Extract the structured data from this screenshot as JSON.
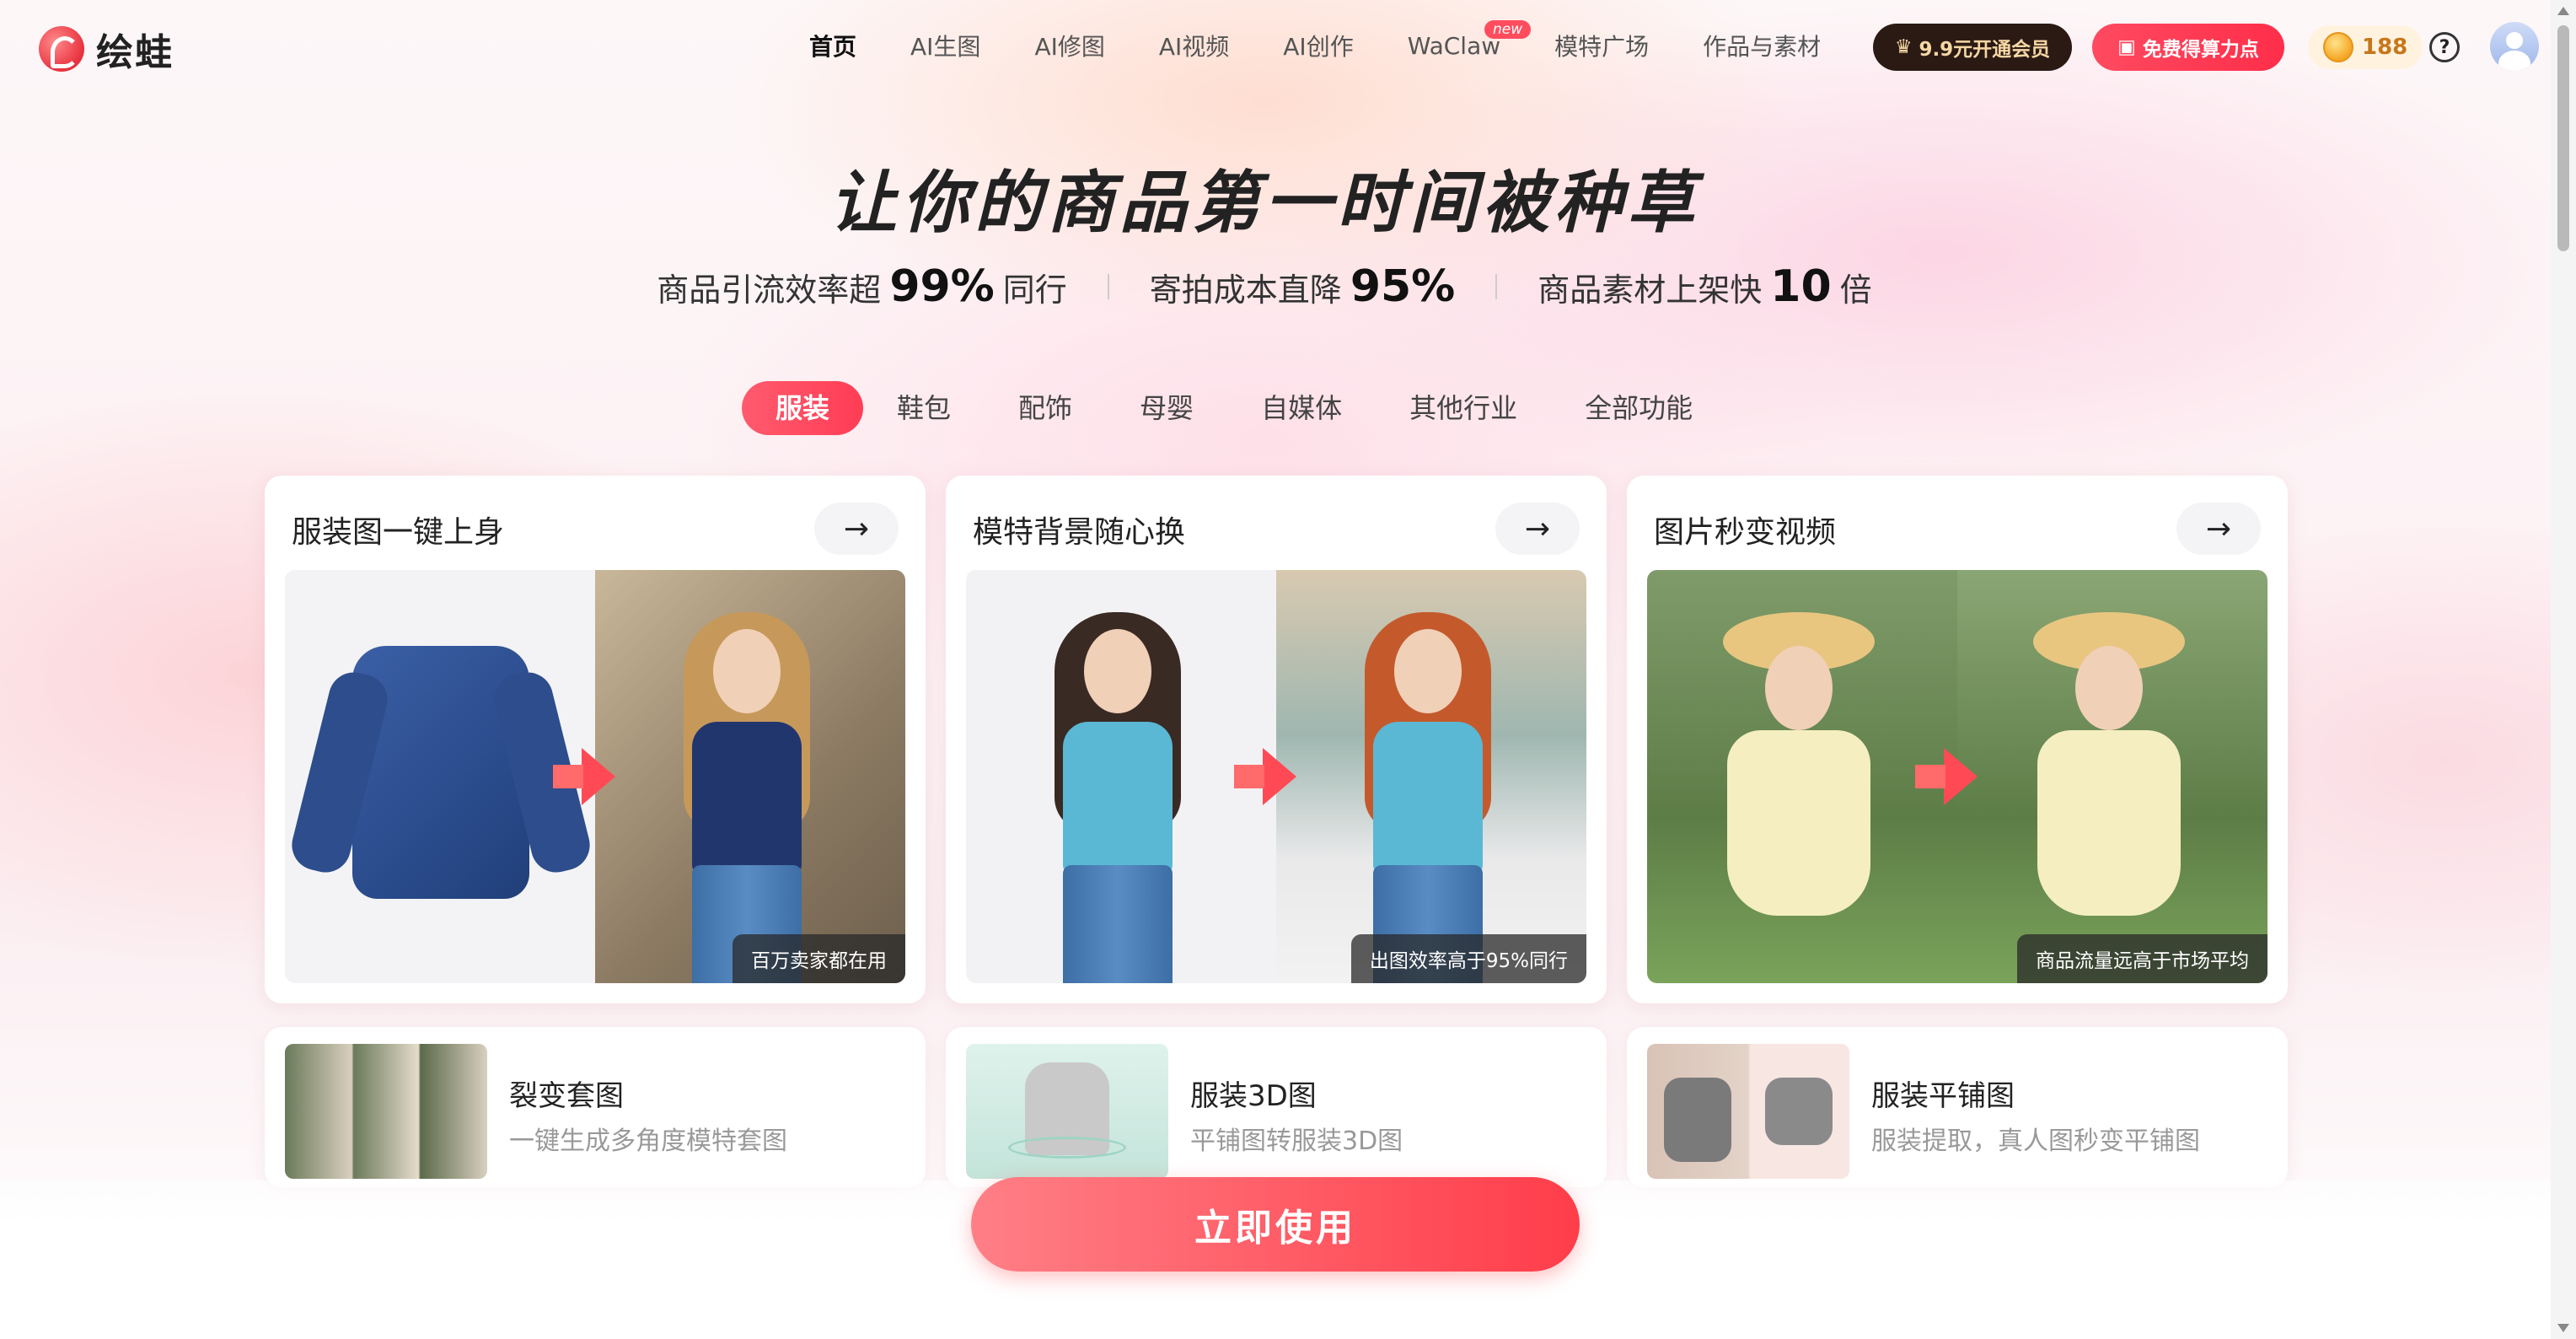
{
  "brand": {
    "name": "绘蛙"
  },
  "nav": [
    {
      "label": "首页",
      "active": true
    },
    {
      "label": "AI生图"
    },
    {
      "label": "AI修图"
    },
    {
      "label": "AI视频"
    },
    {
      "label": "AI创作"
    },
    {
      "label": "WaClaw",
      "badge": "new"
    },
    {
      "label": "模特广场"
    },
    {
      "label": "作品与素材"
    }
  ],
  "header": {
    "vip_label": "9.9元开通会员",
    "free_label": "免费得算力点",
    "coin_count": "188",
    "help_glyph": "?"
  },
  "hero": {
    "title": "让你的商品第一时间被种草",
    "stats": [
      {
        "prefix": "商品引流效率超",
        "value": "99%",
        "suffix": "同行"
      },
      {
        "prefix": "寄拍成本直降",
        "value": "95%",
        "suffix": ""
      },
      {
        "prefix": "商品素材上架快",
        "value": "10",
        "suffix": "倍"
      }
    ]
  },
  "tabs": [
    {
      "label": "服装",
      "active": true
    },
    {
      "label": "鞋包"
    },
    {
      "label": "配饰"
    },
    {
      "label": "母婴"
    },
    {
      "label": "自媒体"
    },
    {
      "label": "其他行业"
    },
    {
      "label": "全部功能"
    }
  ],
  "cards": [
    {
      "title": "服装图一键上身",
      "caption": "百万卖家都在用",
      "arrow": "→"
    },
    {
      "title": "模特背景随心换",
      "caption": "出图效率高于95%同行",
      "arrow": "→"
    },
    {
      "title": "图片秒变视频",
      "caption": "商品流量远高于市场平均",
      "arrow": "→"
    }
  ],
  "features": [
    {
      "name": "裂变套图",
      "desc": "一键生成多角度模特套图"
    },
    {
      "name": "服装3D图",
      "desc": "平铺图转服装3D图"
    },
    {
      "name": "服装平铺图",
      "desc": "服装提取，真人图秒变平铺图"
    }
  ],
  "cta": {
    "label": "立即使用"
  },
  "colors": {
    "accent": "#ff3d55",
    "vip_bg": "#2b1a14",
    "coin": "#f6a623"
  }
}
